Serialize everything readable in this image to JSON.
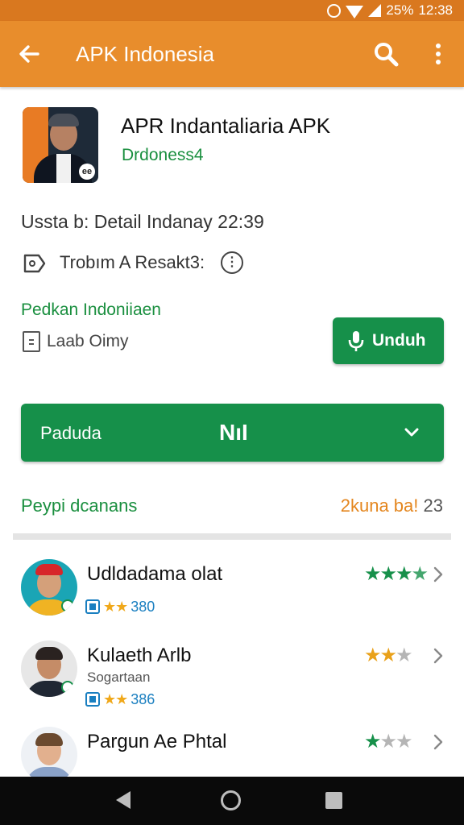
{
  "status_bar": {
    "battery": "25%",
    "time": "12:38"
  },
  "app_bar": {
    "title": "APK Indonesia"
  },
  "app": {
    "name": "APR Indantaliaria APK",
    "developer": "Drdoness4",
    "detail": "Ussta b: Detail Indanay 22:39",
    "tag": "Trobım A Resakt3:",
    "link": "Pedkan Indoniiaen",
    "size": "Laab Oimy"
  },
  "download_button": {
    "label": "Unduh"
  },
  "dropdown": {
    "label": "Paduda",
    "value": "NıI"
  },
  "section": {
    "left": "Peypi dcanans",
    "right_prefix": "2kuna ba!",
    "right_num": "23"
  },
  "reviews": [
    {
      "name": "Udldadama olat",
      "subtitle": "",
      "count": "380",
      "mini_stars": "★★",
      "stars": [
        "on",
        "on",
        "half",
        "off"
      ],
      "star_color": "green"
    },
    {
      "name": "Kulaeth Arlb",
      "subtitle": "Sogartaan",
      "count": "386",
      "mini_stars": "★★",
      "stars": [
        "on",
        "on",
        "off"
      ],
      "star_color": "orange"
    },
    {
      "name": "Pargun Ae Phtal",
      "subtitle": "",
      "count": "",
      "mini_stars": "",
      "stars": [
        "on",
        "off",
        "off"
      ],
      "star_color": "green"
    }
  ],
  "colors": {
    "app_bar": "#e88d2c",
    "status_bar": "#d9781f",
    "accent_green": "#16904a",
    "accent_orange": "#e4861e"
  },
  "icons": [
    "alarm-icon",
    "wifi-icon",
    "signal-icon",
    "back-icon",
    "search-icon",
    "more-icon",
    "tag-icon",
    "info-icon",
    "file-icon",
    "mic-icon",
    "chevron-down-icon",
    "chevron-right-icon",
    "nav-back-icon",
    "nav-home-icon",
    "nav-recents-icon"
  ]
}
